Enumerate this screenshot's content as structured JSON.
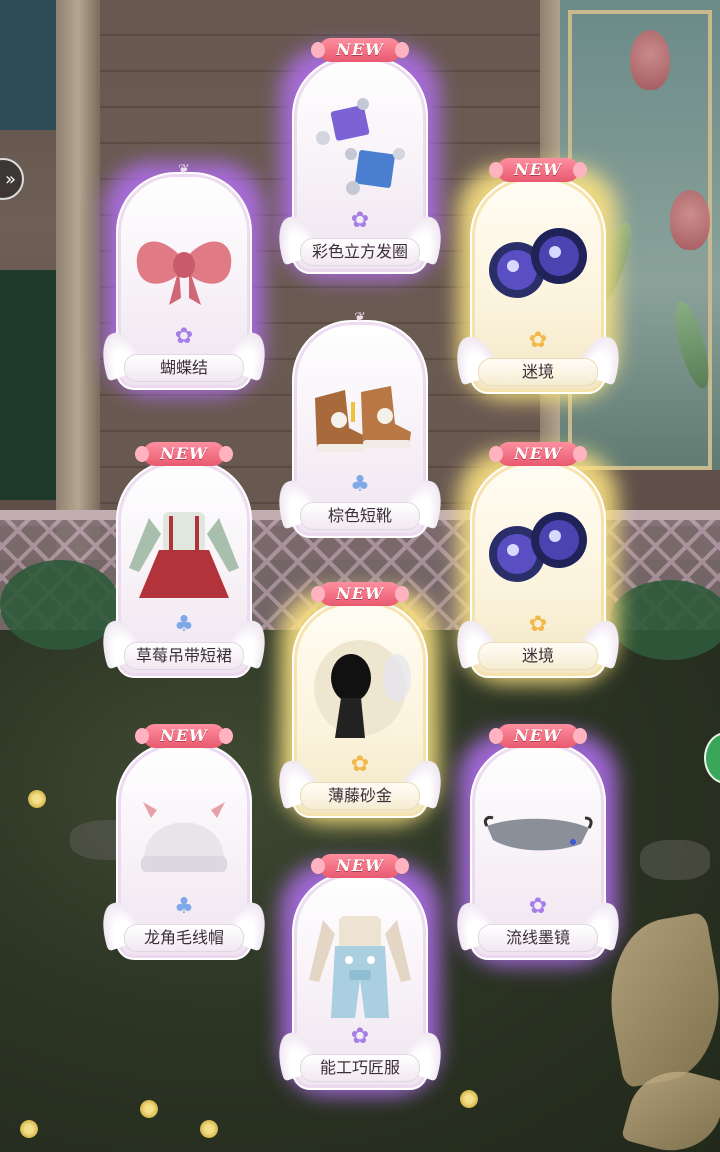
{
  "new_badge": "NEW",
  "cards": [
    {
      "id": "hairband",
      "name": "彩色立方发圈",
      "is_new": true,
      "rarity": "purple",
      "icon": "colorful-cube-hairband-icon"
    },
    {
      "id": "bow",
      "name": "蝴蝶结",
      "is_new": false,
      "rarity": "purple",
      "icon": "pink-bow-icon"
    },
    {
      "id": "eyes1",
      "name": "迷境",
      "is_new": true,
      "rarity": "gold",
      "icon": "galaxy-eyes-icon"
    },
    {
      "id": "boots",
      "name": "棕色短靴",
      "is_new": false,
      "rarity": "blue",
      "icon": "brown-boots-icon"
    },
    {
      "id": "dress",
      "name": "草莓吊带短裙",
      "is_new": true,
      "rarity": "blue",
      "icon": "strawberry-suspender-dress-icon"
    },
    {
      "id": "eyes2",
      "name": "迷境",
      "is_new": true,
      "rarity": "gold",
      "icon": "galaxy-eyes-icon"
    },
    {
      "id": "hair",
      "name": "薄藤砂金",
      "is_new": true,
      "rarity": "gold",
      "icon": "blonde-braided-hair-icon"
    },
    {
      "id": "hat",
      "name": "龙角毛线帽",
      "is_new": true,
      "rarity": "blue",
      "icon": "dragon-horn-knit-hat-icon"
    },
    {
      "id": "sunglasses",
      "name": "流线墨镜",
      "is_new": true,
      "rarity": "purple",
      "icon": "streamline-sunglasses-icon"
    },
    {
      "id": "overalls",
      "name": "能工巧匠服",
      "is_new": true,
      "rarity": "purple",
      "icon": "craftsman-overalls-icon"
    }
  ],
  "colors": {
    "purple_glow": "#b26ef0",
    "gold_glow": "#fae182",
    "new_badge": "#e8596f"
  }
}
